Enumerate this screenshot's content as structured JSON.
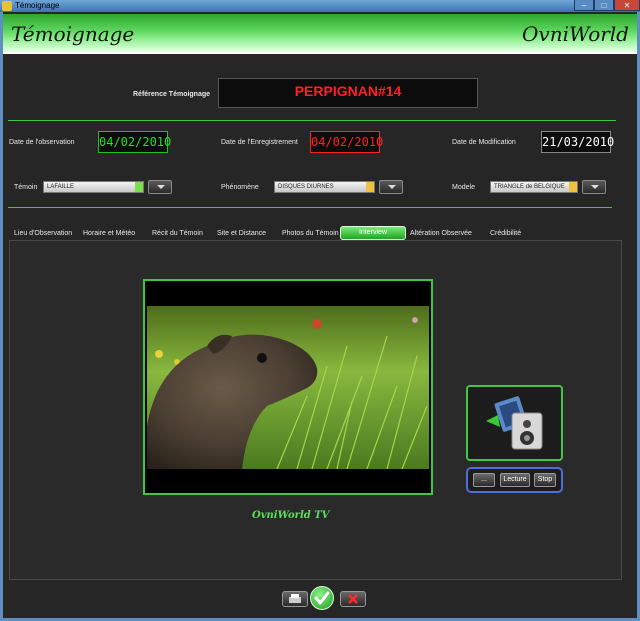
{
  "window": {
    "title": "Témoignage"
  },
  "header": {
    "title_left": "Témoignage",
    "title_right": "OvniWorld"
  },
  "reference": {
    "label": "Référence Témoignage",
    "value": "PERPIGNAN#14"
  },
  "dates": {
    "observation": {
      "label": "Date de l'observation",
      "value": "04/02/2010",
      "color": "#22e022"
    },
    "enregistrement": {
      "label": "Date de l'Enregistrement",
      "value": "04/02/2010",
      "color": "#ff2020"
    },
    "modification": {
      "label": "Date de Modification",
      "value": "21/03/2010",
      "color": "#ffffff"
    }
  },
  "fields": {
    "temoin": {
      "label": "Témoin",
      "value": "LAFAILLE",
      "arrow_color": "#7ae04a"
    },
    "phenomene": {
      "label": "Phénomène",
      "value": "DISQUES DIURNES",
      "arrow_color": "#f0c040"
    },
    "modele": {
      "label": "Modele",
      "value": "TRIANGLE de BELGIQUE",
      "arrow_color": "#f0c040"
    }
  },
  "tabs": [
    {
      "label": "Lieu d'Observation",
      "active": false
    },
    {
      "label": "Horaire et Météo",
      "active": false
    },
    {
      "label": "Récit du Témoin",
      "active": false
    },
    {
      "label": "Site et Distance",
      "active": false
    },
    {
      "label": "Photos du Témoin",
      "active": false
    },
    {
      "label": "Interview",
      "active": true
    },
    {
      "label": "Altération Observée",
      "active": false
    },
    {
      "label": "Crédibilité",
      "active": false
    }
  ],
  "media": {
    "caption": "OvniWorld TV",
    "controls": {
      "more_label": "...",
      "play_label": "Lecture",
      "stop_label": "Stop"
    }
  },
  "colors": {
    "accent": "#3fc83f",
    "banner": "#5fd85f",
    "reference_text": "#ff2020",
    "control_border": "#4f6fd8"
  },
  "icons": [
    "app-icon",
    "media-player-icon",
    "print-icon",
    "check-icon",
    "cancel-icon"
  ]
}
